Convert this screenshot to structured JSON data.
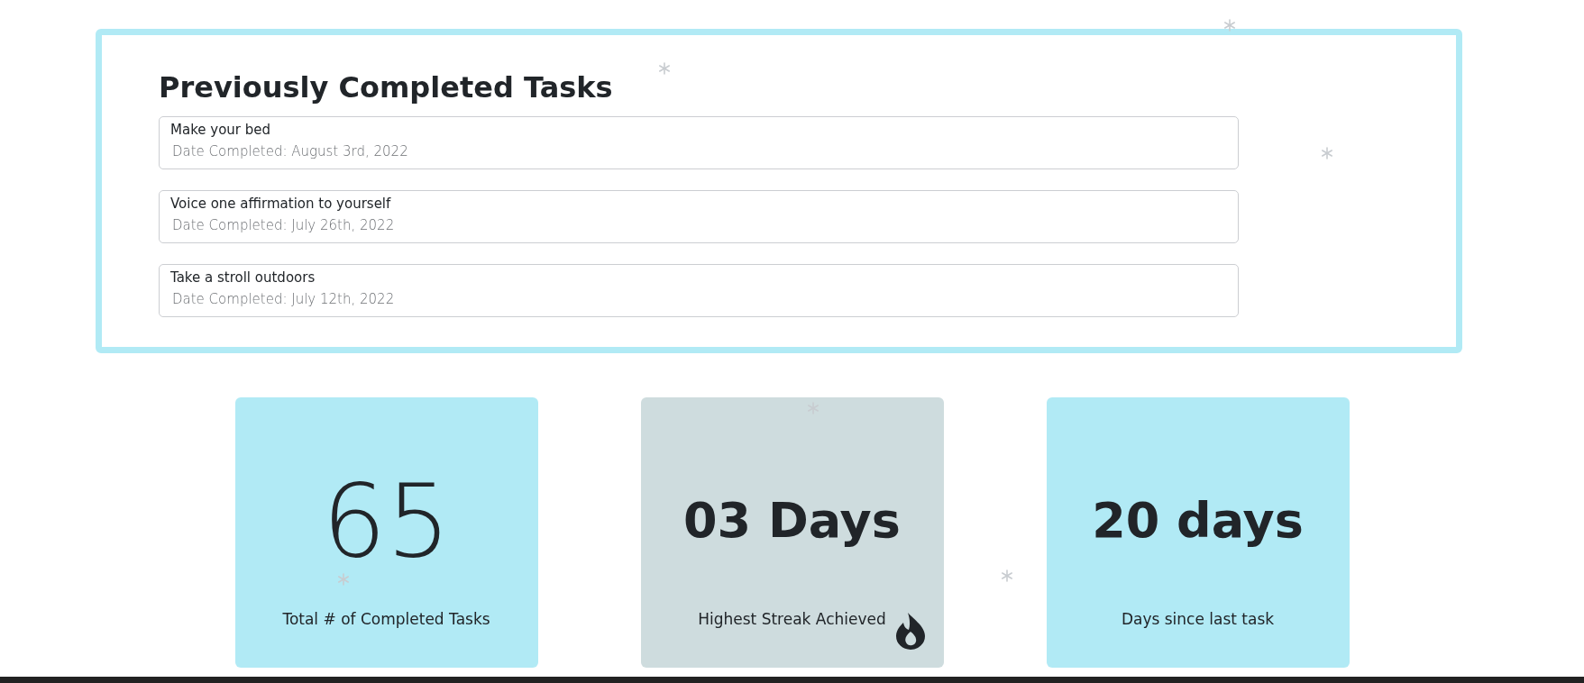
{
  "completed_tasks": {
    "title": "Previously Completed Tasks",
    "items": [
      {
        "name": "Make your bed",
        "date": "Date Completed: August 3rd, 2022"
      },
      {
        "name": "Voice one affirmation to yourself",
        "date": "Date Completed: July 26th, 2022"
      },
      {
        "name": "Take a stroll outdoors",
        "date": "Date Completed: July 12th, 2022"
      }
    ]
  },
  "stats": [
    {
      "kind": "light",
      "value": "65",
      "label": "Total # of Completed Tasks",
      "color": "#b1eaf5",
      "flame": false
    },
    {
      "kind": "bold",
      "value": "03 Days",
      "label": "Highest Streak Achieved",
      "color": "#cedcde",
      "flame": true
    },
    {
      "kind": "bold",
      "value": "20 days",
      "label": "Days since last task",
      "color": "#b1eaf5",
      "flame": false
    }
  ]
}
